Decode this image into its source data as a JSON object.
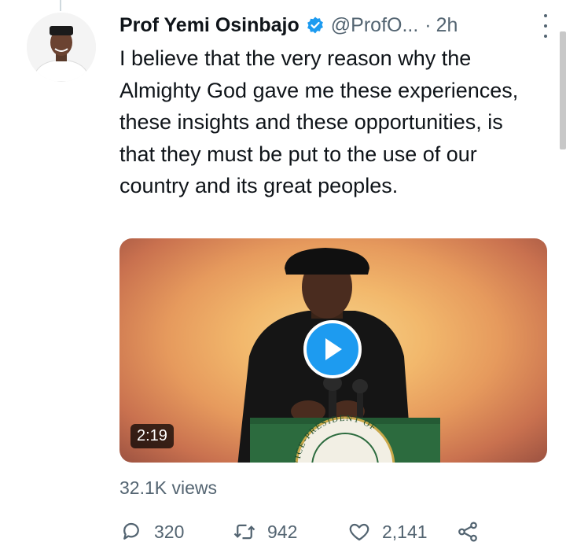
{
  "tweet": {
    "author_name": "Prof Yemi Osinbajo",
    "handle": "@ProfO...",
    "separator": "·",
    "time": "2h",
    "text": "I believe that the very reason why the Almighty God gave me these experiences, these insights and these opportunities, is that they must be put to the use of our country and its great peoples."
  },
  "media": {
    "duration": "2:19",
    "podium_text": "VICE-PRESIDENT OF"
  },
  "stats": {
    "views": "32.1K views"
  },
  "actions": {
    "replies": "320",
    "retweets": "942",
    "likes": "2,141"
  },
  "colors": {
    "accent": "#1d9bf0",
    "secondary_text": "#536471",
    "primary_text": "#0f1419"
  }
}
